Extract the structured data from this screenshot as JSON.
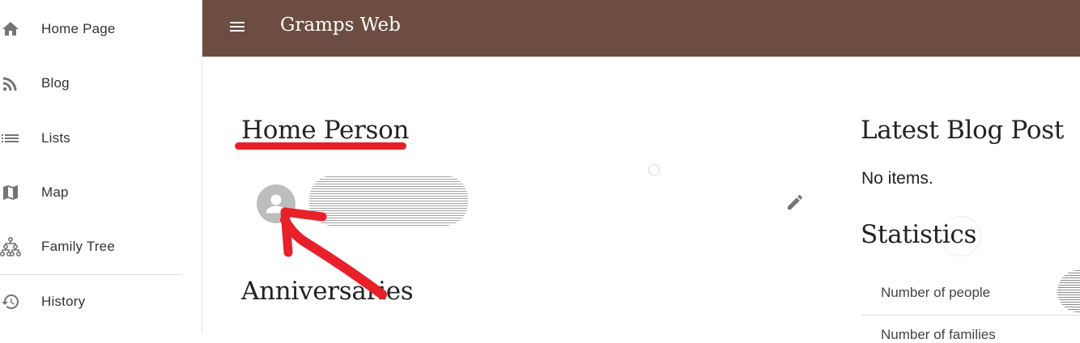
{
  "app": {
    "title": "Gramps Web"
  },
  "sidebar": {
    "items": [
      {
        "label": "Home Page",
        "icon": "home-icon"
      },
      {
        "label": "Blog",
        "icon": "rss-icon"
      },
      {
        "label": "Lists",
        "icon": "list-icon"
      },
      {
        "label": "Map",
        "icon": "map-icon"
      },
      {
        "label": "Family Tree",
        "icon": "family-tree-icon"
      },
      {
        "label": "History",
        "icon": "history-icon"
      }
    ]
  },
  "main": {
    "home_person": {
      "heading": "Home Person",
      "avatar_icon": "person-icon",
      "edit_icon": "pencil-icon"
    },
    "anniversaries": {
      "heading": "Anniversaries"
    }
  },
  "right": {
    "blog": {
      "heading": "Latest Blog Post",
      "empty_text": "No items."
    },
    "statistics": {
      "heading": "Statistics",
      "rows": [
        {
          "label": "Number of people"
        },
        {
          "label": "Number of families"
        }
      ]
    }
  },
  "colors": {
    "topbar": "#6d4c41",
    "annotation_red": "#e8202a",
    "avatar_bg": "#bdbdbd",
    "icon_gray": "#757575"
  }
}
